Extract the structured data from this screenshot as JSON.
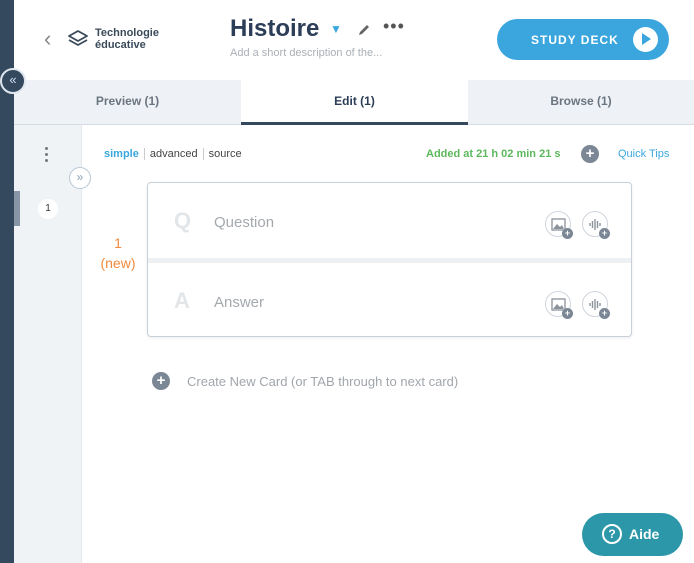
{
  "colors": {
    "accent": "#3aa6dd",
    "rail": "#34485e",
    "success": "#5cb85c",
    "new_card": "#f08a3c",
    "help": "#2c97a8"
  },
  "header": {
    "folder": "Technologie éducative",
    "title": "Histoire",
    "description_placeholder": "Add a short description of the...",
    "study_label": "STUDY DECK",
    "icons": {
      "back": "chevron-left-icon",
      "folder": "layers-icon",
      "caret": "caret-down-icon",
      "edit": "pencil-icon",
      "more": "more-horizontal-icon",
      "study": "play-icon"
    }
  },
  "tabs": [
    {
      "label": "Preview (1)"
    },
    {
      "label": "Edit (1)",
      "active": true
    },
    {
      "label": "Browse (1)"
    }
  ],
  "editor": {
    "modes": [
      "simple",
      "advanced",
      "source"
    ],
    "active_mode": "simple",
    "added_status": "Added at 21 h 02 min 21 s",
    "quick_tips": "Quick Tips",
    "card_number": "1",
    "card_state": "(new)",
    "card_index": "1",
    "question": {
      "letter": "Q",
      "placeholder": "Question"
    },
    "answer": {
      "letter": "A",
      "placeholder": "Answer"
    },
    "create_label": "Create New Card (or TAB through to next card)"
  },
  "help": {
    "label": "Aide",
    "icon": "help-circle-icon"
  }
}
